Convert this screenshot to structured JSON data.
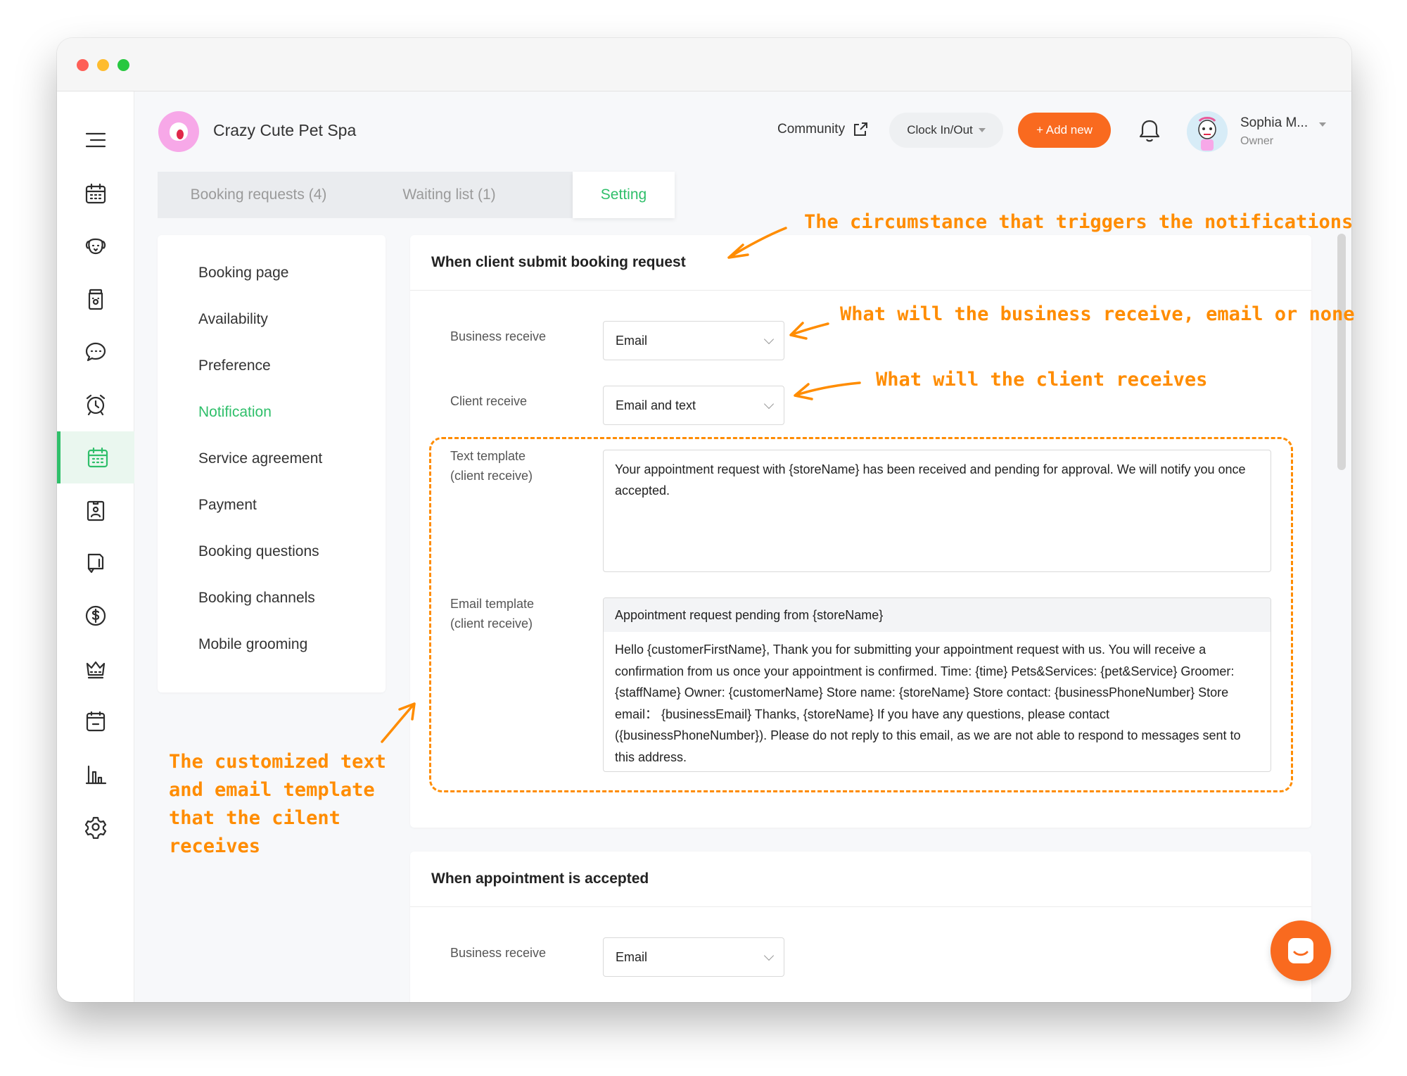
{
  "window": {
    "controls": [
      "close",
      "minimize",
      "maximize"
    ]
  },
  "sidebar": {
    "items": [
      {
        "icon": "menu-icon"
      },
      {
        "icon": "calendar-icon"
      },
      {
        "icon": "pet-icon"
      },
      {
        "icon": "jar-icon"
      },
      {
        "icon": "chat-icon"
      },
      {
        "icon": "alarm-icon"
      },
      {
        "icon": "booking-calendar-icon",
        "active": true
      },
      {
        "icon": "badge-icon"
      },
      {
        "icon": "document-icon"
      },
      {
        "icon": "dollar-icon"
      },
      {
        "icon": "crown-icon"
      },
      {
        "icon": "register-icon"
      },
      {
        "icon": "chart-icon"
      },
      {
        "icon": "gear-icon"
      }
    ],
    "active_color": "#2fbf6a"
  },
  "header": {
    "store_name": "Crazy Cute Pet Spa",
    "community_label": "Community",
    "clock_label": "Clock In/Out",
    "add_new_label": "+ Add new",
    "add_new_color": "#f96a1f",
    "user": {
      "name": "Sophia M...",
      "role": "Owner"
    }
  },
  "tabs": [
    {
      "label": "Booking requests (4)"
    },
    {
      "label": "Waiting list (1)"
    },
    {
      "label": "Setting",
      "active": true
    }
  ],
  "settings_menu": [
    {
      "label": "Booking page"
    },
    {
      "label": "Availability"
    },
    {
      "label": "Preference"
    },
    {
      "label": "Notification",
      "active": true
    },
    {
      "label": "Service agreement"
    },
    {
      "label": "Payment"
    },
    {
      "label": "Booking questions"
    },
    {
      "label": "Booking channels"
    },
    {
      "label": "Mobile grooming"
    }
  ],
  "sections": [
    {
      "title": "When client submit booking request",
      "business_receive": {
        "label": "Business receive",
        "value": "Email"
      },
      "client_receive": {
        "label": "Client receive",
        "value": "Email and text"
      },
      "text_template": {
        "label_line1": "Text template",
        "label_line2": "(client receive)",
        "value": "Your appointment request with {storeName} has been received and pending for approval. We will notify you once accepted."
      },
      "email_template": {
        "label_line1": "Email template",
        "label_line2": "(client receive)",
        "subject": "Appointment request pending from {storeName}",
        "body": "Hello {customerFirstName}, Thank you for submitting your appointment request with us. You will receive a confirmation from us once your appointment is confirmed. Time: {time} Pets&Services: {pet&Service} Groomer: {staffName} Owner: {customerName} Store name: {storeName} Store contact: {businessPhoneNumber} Store email： {businessEmail} Thanks, {storeName} If you have any questions, please contact ({businessPhoneNumber}). Please do not reply to this email, as we are not able to respond to messages sent to this address."
      }
    },
    {
      "title": "When appointment is accepted",
      "business_receive": {
        "label": "Business receive",
        "value": "Email"
      }
    }
  ],
  "annotations": {
    "color": "#ff8c00",
    "trigger": "The circumstance that triggers the notifications",
    "business": "What will the business receive, email or none",
    "client": "What will the client receives",
    "template_line1": "The customized text",
    "template_line2": "and email template",
    "template_line3": "that the cilent",
    "template_line4": "receives"
  }
}
